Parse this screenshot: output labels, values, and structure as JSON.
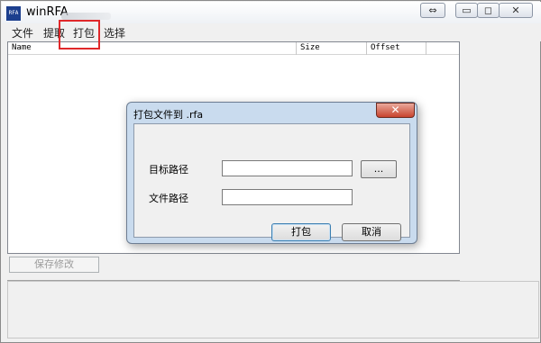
{
  "window": {
    "title": "winRFA",
    "icon_text": "RFA",
    "controls": {
      "restore": "⇔",
      "minimize": "▭",
      "maximize": "◻",
      "close": "✕"
    }
  },
  "menu": {
    "items": [
      {
        "label": "文件"
      },
      {
        "label": "提取"
      },
      {
        "label": "打包"
      },
      {
        "label": "选择"
      }
    ],
    "highlight_color": "#e0282a"
  },
  "list": {
    "columns": [
      {
        "label": "Name"
      },
      {
        "label": "Size"
      },
      {
        "label": "Offset"
      }
    ],
    "rows": []
  },
  "main": {
    "save_label": "保存修改"
  },
  "dialog": {
    "title": "打包文件到 .rfa",
    "close_icon": "✕",
    "target_label": "目标路径",
    "target_value": "",
    "browse_label": "...",
    "file_label": "文件路径",
    "file_value": "",
    "ok_label": "打包",
    "cancel_label": "取消"
  }
}
